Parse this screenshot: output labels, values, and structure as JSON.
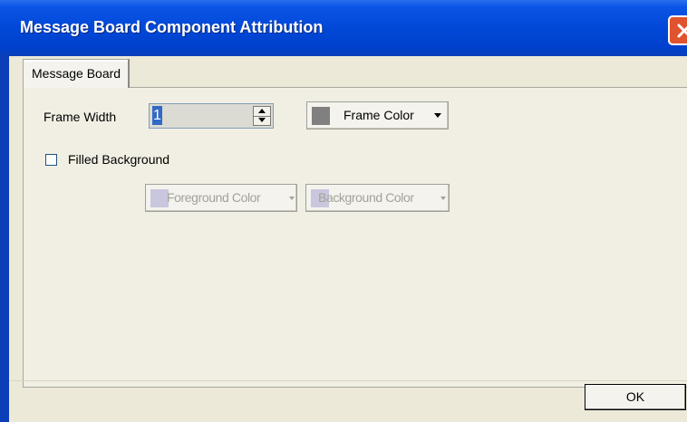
{
  "window": {
    "title": "Message Board Component Attribution",
    "close_icon": "close-icon"
  },
  "tabs": [
    {
      "label": "Message Board",
      "selected": true
    }
  ],
  "frame_width": {
    "label": "Frame Width",
    "value": "1",
    "spinner_icon": "spinner-arrows-icon"
  },
  "frame_color": {
    "label": "Frame Color",
    "swatch_color": "#808080",
    "icon": "chevron-down-icon"
  },
  "filled_background": {
    "label": "Filled Background",
    "checked": false
  },
  "foreground_color": {
    "label": "Foreground Color",
    "swatch_color": "#c9c6de",
    "enabled": false
  },
  "background_color": {
    "label": "Background Color",
    "swatch_color": "#c9c6de",
    "enabled": false
  },
  "footer": {
    "ok_label": "OK"
  },
  "colors": {
    "titlebar": "#0148d8",
    "dialog_bg": "#ece9d8",
    "panel_bg": "#f1efe3",
    "selection": "#316ac5",
    "close_button": "#e0532f"
  }
}
